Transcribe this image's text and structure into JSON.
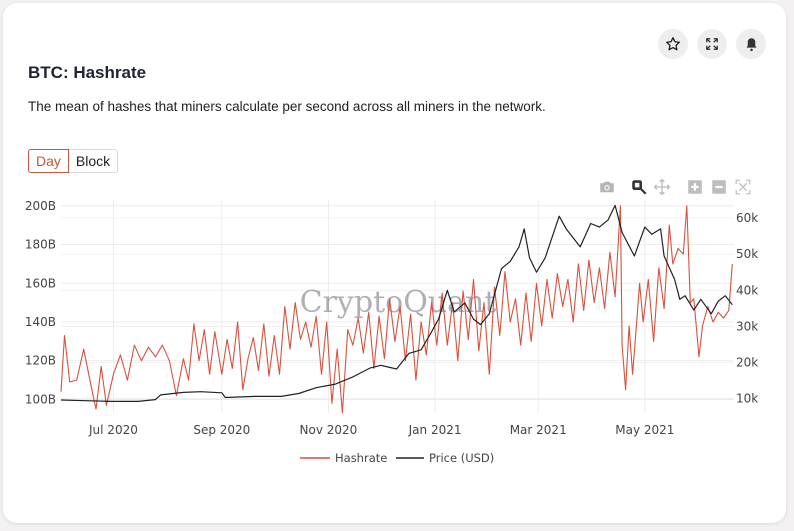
{
  "header": {
    "title": "BTC: Hashrate",
    "description": "The mean of hashes that miners calculate per second across all miners in the network.",
    "buttons": [
      {
        "name": "favorite",
        "icon": "star-icon"
      },
      {
        "name": "fullscreen",
        "icon": "expand-icon"
      },
      {
        "name": "alert",
        "icon": "bell-icon"
      }
    ]
  },
  "toggle": {
    "options": [
      "Day",
      "Block"
    ],
    "selected": "Day"
  },
  "modebar": [
    {
      "name": "download-png",
      "icon": "camera-icon"
    },
    {
      "name": "zoom",
      "icon": "zoom-icon",
      "active": true
    },
    {
      "name": "pan",
      "icon": "pan-icon"
    },
    {
      "name": "zoom-in",
      "icon": "plus-square-icon"
    },
    {
      "name": "zoom-out",
      "icon": "minus-square-icon"
    },
    {
      "name": "autoscale",
      "icon": "autoscale-icon"
    }
  ],
  "watermark": "CryptoQuant",
  "colors": {
    "hashrate": "#d9513c",
    "price": "#1e2226",
    "accent": "#c8553d"
  },
  "chart_data": {
    "type": "line",
    "title": "BTC: Hashrate",
    "x_range": [
      "2020-06-01",
      "2021-06-01"
    ],
    "x_ticks": [
      "Jul 2020",
      "Sep 2020",
      "Nov 2020",
      "Jan 2021",
      "Mar 2021",
      "May 2021"
    ],
    "y_left": {
      "label": "",
      "range": [
        93,
        203
      ],
      "ticks": [
        "100B",
        "120B",
        "140B",
        "160B",
        "180B",
        "200B"
      ],
      "tick_values": [
        100,
        120,
        140,
        160,
        180,
        200
      ]
    },
    "y_right": {
      "label": "",
      "range": [
        6,
        65
      ],
      "ticks": [
        "10k",
        "20k",
        "30k",
        "40k",
        "50k",
        "60k"
      ],
      "tick_values": [
        10,
        20,
        30,
        40,
        50,
        60
      ]
    },
    "grid": true,
    "legend": "bottom-center",
    "series": [
      {
        "name": "Hashrate",
        "axis": "left",
        "unit": "B hashes/s",
        "points": [
          [
            "2020-06-01",
            104
          ],
          [
            "2020-06-03",
            133
          ],
          [
            "2020-06-06",
            109
          ],
          [
            "2020-06-10",
            110
          ],
          [
            "2020-06-14",
            126
          ],
          [
            "2020-06-18",
            108
          ],
          [
            "2020-06-21",
            95
          ],
          [
            "2020-06-24",
            117
          ],
          [
            "2020-06-27",
            97
          ],
          [
            "2020-07-01",
            113
          ],
          [
            "2020-07-05",
            123
          ],
          [
            "2020-07-09",
            110
          ],
          [
            "2020-07-13",
            128
          ],
          [
            "2020-07-17",
            120
          ],
          [
            "2020-07-21",
            127
          ],
          [
            "2020-07-25",
            122
          ],
          [
            "2020-07-29",
            128
          ],
          [
            "2020-08-02",
            120
          ],
          [
            "2020-08-06",
            102
          ],
          [
            "2020-08-10",
            121
          ],
          [
            "2020-08-13",
            110
          ],
          [
            "2020-08-16",
            139
          ],
          [
            "2020-08-19",
            120
          ],
          [
            "2020-08-22",
            136
          ],
          [
            "2020-08-25",
            113
          ],
          [
            "2020-08-28",
            135
          ],
          [
            "2020-09-01",
            113
          ],
          [
            "2020-09-04",
            131
          ],
          [
            "2020-09-07",
            116
          ],
          [
            "2020-09-10",
            140
          ],
          [
            "2020-09-13",
            105
          ],
          [
            "2020-09-16",
            121
          ],
          [
            "2020-09-19",
            132
          ],
          [
            "2020-09-22",
            115
          ],
          [
            "2020-09-25",
            139
          ],
          [
            "2020-09-28",
            112
          ],
          [
            "2020-10-01",
            133
          ],
          [
            "2020-10-04",
            113
          ],
          [
            "2020-10-07",
            148
          ],
          [
            "2020-10-10",
            126
          ],
          [
            "2020-10-13",
            150
          ],
          [
            "2020-10-16",
            131
          ],
          [
            "2020-10-19",
            140
          ],
          [
            "2020-10-22",
            127
          ],
          [
            "2020-10-25",
            143
          ],
          [
            "2020-10-28",
            113
          ],
          [
            "2020-10-31",
            140
          ],
          [
            "2020-11-03",
            98
          ],
          [
            "2020-11-06",
            126
          ],
          [
            "2020-11-09",
            93
          ],
          [
            "2020-11-12",
            136
          ],
          [
            "2020-11-15",
            128
          ],
          [
            "2020-11-18",
            142
          ],
          [
            "2020-11-21",
            124
          ],
          [
            "2020-11-24",
            145
          ],
          [
            "2020-11-27",
            116
          ],
          [
            "2020-11-30",
            143
          ],
          [
            "2020-12-03",
            121
          ],
          [
            "2020-12-06",
            152
          ],
          [
            "2020-12-09",
            130
          ],
          [
            "2020-12-12",
            148
          ],
          [
            "2020-12-15",
            120
          ],
          [
            "2020-12-18",
            144
          ],
          [
            "2020-12-21",
            110
          ],
          [
            "2020-12-24",
            140
          ],
          [
            "2020-12-27",
            123
          ],
          [
            "2020-12-30",
            150
          ],
          [
            "2021-01-02",
            128
          ],
          [
            "2021-01-05",
            155
          ],
          [
            "2021-01-08",
            128
          ],
          [
            "2021-01-11",
            150
          ],
          [
            "2021-01-14",
            120
          ],
          [
            "2021-01-17",
            156
          ],
          [
            "2021-01-20",
            131
          ],
          [
            "2021-01-23",
            162
          ],
          [
            "2021-01-26",
            125
          ],
          [
            "2021-01-29",
            150
          ],
          [
            "2021-02-01",
            113
          ],
          [
            "2021-02-04",
            158
          ],
          [
            "2021-02-07",
            133
          ],
          [
            "2021-02-10",
            166
          ],
          [
            "2021-02-13",
            140
          ],
          [
            "2021-02-16",
            152
          ],
          [
            "2021-02-19",
            128
          ],
          [
            "2021-02-22",
            155
          ],
          [
            "2021-02-25",
            130
          ],
          [
            "2021-02-28",
            160
          ],
          [
            "2021-03-03",
            138
          ],
          [
            "2021-03-06",
            162
          ],
          [
            "2021-03-09",
            142
          ],
          [
            "2021-03-12",
            165
          ],
          [
            "2021-03-15",
            148
          ],
          [
            "2021-03-18",
            162
          ],
          [
            "2021-03-21",
            140
          ],
          [
            "2021-03-24",
            170
          ],
          [
            "2021-03-27",
            146
          ],
          [
            "2021-03-30",
            172
          ],
          [
            "2021-04-02",
            150
          ],
          [
            "2021-04-05",
            168
          ],
          [
            "2021-04-08",
            147
          ],
          [
            "2021-04-11",
            176
          ],
          [
            "2021-04-14",
            153
          ],
          [
            "2021-04-17",
            200
          ],
          [
            "2021-04-18",
            128
          ],
          [
            "2021-04-20",
            105
          ],
          [
            "2021-04-22",
            138
          ],
          [
            "2021-04-24",
            113
          ],
          [
            "2021-04-26",
            136
          ],
          [
            "2021-04-28",
            160
          ],
          [
            "2021-04-30",
            140
          ],
          [
            "2021-05-03",
            162
          ],
          [
            "2021-05-06",
            130
          ],
          [
            "2021-05-09",
            168
          ],
          [
            "2021-05-12",
            147
          ],
          [
            "2021-05-15",
            190
          ],
          [
            "2021-05-17",
            170
          ],
          [
            "2021-05-20",
            178
          ],
          [
            "2021-05-23",
            175
          ],
          [
            "2021-05-25",
            200
          ],
          [
            "2021-05-27",
            150
          ],
          [
            "2021-05-29",
            152
          ],
          [
            "2021-06-01",
            122
          ],
          [
            "2021-06-03",
            138
          ],
          [
            "2021-06-06",
            148
          ],
          [
            "2021-06-09",
            140
          ],
          [
            "2021-06-12",
            145
          ],
          [
            "2021-06-15",
            142
          ],
          [
            "2021-06-18",
            146
          ],
          [
            "2021-06-20",
            170
          ]
        ]
      },
      {
        "name": "Price (USD)",
        "axis": "right",
        "unit": "k USD",
        "points": [
          [
            "2020-06-01",
            9.6
          ],
          [
            "2020-06-15",
            9.4
          ],
          [
            "2020-06-30",
            9.2
          ],
          [
            "2020-07-15",
            9.2
          ],
          [
            "2020-07-25",
            9.7
          ],
          [
            "2020-07-28",
            11.0
          ],
          [
            "2020-08-10",
            11.7
          ],
          [
            "2020-08-20",
            11.9
          ],
          [
            "2020-09-01",
            11.6
          ],
          [
            "2020-09-03",
            10.3
          ],
          [
            "2020-09-20",
            10.6
          ],
          [
            "2020-10-05",
            10.6
          ],
          [
            "2020-10-15",
            11.4
          ],
          [
            "2020-10-25",
            13.0
          ],
          [
            "2020-11-05",
            14.0
          ],
          [
            "2020-11-15",
            16.0
          ],
          [
            "2020-11-25",
            18.5
          ],
          [
            "2020-12-01",
            19.2
          ],
          [
            "2020-12-10",
            18.2
          ],
          [
            "2020-12-17",
            22.5
          ],
          [
            "2020-12-24",
            23.5
          ],
          [
            "2020-12-30",
            28.5
          ],
          [
            "2021-01-03",
            32.0
          ],
          [
            "2021-01-08",
            40.0
          ],
          [
            "2021-01-12",
            34.0
          ],
          [
            "2021-01-18",
            36.5
          ],
          [
            "2021-01-23",
            32.0
          ],
          [
            "2021-01-27",
            30.5
          ],
          [
            "2021-02-01",
            33.5
          ],
          [
            "2021-02-08",
            46.0
          ],
          [
            "2021-02-13",
            48.0
          ],
          [
            "2021-02-18",
            52.0
          ],
          [
            "2021-02-21",
            57.0
          ],
          [
            "2021-02-24",
            49.0
          ],
          [
            "2021-02-28",
            45.0
          ],
          [
            "2021-03-05",
            49.0
          ],
          [
            "2021-03-13",
            60.5
          ],
          [
            "2021-03-17",
            57.0
          ],
          [
            "2021-03-25",
            52.0
          ],
          [
            "2021-03-31",
            58.5
          ],
          [
            "2021-04-05",
            57.5
          ],
          [
            "2021-04-10",
            59.5
          ],
          [
            "2021-04-14",
            63.5
          ],
          [
            "2021-04-18",
            56.0
          ],
          [
            "2021-04-25",
            49.5
          ],
          [
            "2021-05-01",
            57.5
          ],
          [
            "2021-05-05",
            55.5
          ],
          [
            "2021-05-10",
            57.0
          ],
          [
            "2021-05-12",
            49.5
          ],
          [
            "2021-05-18",
            43.0
          ],
          [
            "2021-05-21",
            37.5
          ],
          [
            "2021-05-24",
            38.5
          ],
          [
            "2021-05-29",
            34.5
          ],
          [
            "2021-06-02",
            37.5
          ],
          [
            "2021-06-08",
            33.5
          ],
          [
            "2021-06-12",
            37.0
          ],
          [
            "2021-06-16",
            38.5
          ],
          [
            "2021-06-20",
            36.0
          ]
        ]
      }
    ]
  }
}
